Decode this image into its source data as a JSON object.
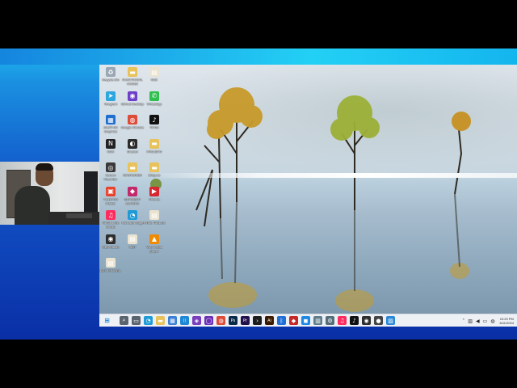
{
  "colors": {
    "stream_background": "#1256c9",
    "taskbar": "#edf1f6",
    "start_accent": "#0078d4"
  },
  "desktop": {
    "wallpaper": "misty lake with trees",
    "icons": [
      {
        "id": "recycle-bin",
        "label": "Recycle Bin",
        "icon": "recycle-bin-icon",
        "color": "#9aa7b4",
        "glyph": "♻"
      },
      {
        "id": "fpdf",
        "label": "FUNCTIONAL CODE2",
        "icon": "folder-icon",
        "color": "#e8c25a",
        "glyph": "▬"
      },
      {
        "id": "nsk",
        "label": "NSK",
        "icon": "document-icon",
        "color": "#e9e3d0",
        "glyph": "▤"
      },
      {
        "id": "telegram",
        "label": "Telegram",
        "icon": "telegram-icon",
        "color": "#2ea6de",
        "glyph": "➤"
      },
      {
        "id": "github",
        "label": "GitHub Desktop",
        "icon": "github-desktop-icon",
        "color": "#6e40c9",
        "glyph": "◉"
      },
      {
        "id": "whatsapp",
        "label": "WhatsApp",
        "icon": "whatsapp-icon",
        "color": "#30c04f",
        "glyph": "✆"
      },
      {
        "id": "intel",
        "label": "Intel® HD Graphics",
        "icon": "intel-graphics-icon",
        "color": "#1e6fd0",
        "glyph": "▦"
      },
      {
        "id": "chrome",
        "label": "Google Chrome",
        "icon": "chrome-icon",
        "color": "#de4b39",
        "glyph": "◍"
      },
      {
        "id": "tiktok",
        "label": "TikTok",
        "icon": "tiktok-icon",
        "color": "#111111",
        "glyph": "♪"
      },
      {
        "id": "nox",
        "label": "NOX",
        "icon": "nox-icon",
        "color": "#222222",
        "glyph": "N"
      },
      {
        "id": "obs",
        "label": "Shotcut",
        "icon": "shotcut-icon",
        "color": "#2b2b2b",
        "glyph": "◐"
      },
      {
        "id": "projeto",
        "label": "PROJETO",
        "icon": "folder-icon",
        "color": "#e8c25a",
        "glyph": "▬"
      },
      {
        "id": "camera",
        "label": "Screen Recorder",
        "icon": "screen-recorder-icon",
        "color": "#3a3a3a",
        "glyph": "◎"
      },
      {
        "id": "mastervids",
        "label": "MASTERIDS",
        "icon": "folder-icon",
        "color": "#e8c25a",
        "glyph": "▬"
      },
      {
        "id": "bloques",
        "label": "Bloques",
        "icon": "folder-icon",
        "color": "#e8c25a",
        "glyph": "▬"
      },
      {
        "id": "toolspro",
        "label": "ToolsPRO Master",
        "icon": "toolspro-icon",
        "color": "#e8432f",
        "glyph": "▣"
      },
      {
        "id": "gradient",
        "label": "GRADIENT BLOCKS",
        "icon": "gradient-icon",
        "color": "#c22a6b",
        "glyph": "◆"
      },
      {
        "id": "filmora",
        "label": "Filmora",
        "icon": "filmora-icon",
        "color": "#d8252f",
        "glyph": "▶"
      },
      {
        "id": "tiktok-live",
        "label": "TikTok LIVE Studio",
        "icon": "tiktok-live-icon",
        "color": "#ff2b5e",
        "glyph": "♫"
      },
      {
        "id": "edge",
        "label": "Microsoft Edge",
        "icon": "edge-icon",
        "color": "#1e9bd7",
        "glyph": "◔"
      },
      {
        "id": "html",
        "label": "HTML TABLES",
        "icon": "document-icon",
        "color": "#e9e3d0",
        "glyph": "▤"
      },
      {
        "id": "obs-studio",
        "label": "OBS Studio",
        "icon": "obs-icon",
        "color": "#2d2d2d",
        "glyph": "◉"
      },
      {
        "id": "vidt",
        "label": "VIDT",
        "icon": "document-icon",
        "color": "#e9e3d0",
        "glyph": "▤"
      },
      {
        "id": "vlc",
        "label": "VLC media player",
        "icon": "vlc-icon",
        "color": "#f08a00",
        "glyph": "▲"
      },
      {
        "id": "bdx",
        "label": "BDX IMMOBIL",
        "icon": "document-icon",
        "color": "#e9e3d0",
        "glyph": "▤"
      }
    ]
  },
  "taskbar": {
    "start_icon": "windows-start-icon",
    "items": [
      {
        "name": "search",
        "icon": "search-icon",
        "color": "#5a6470",
        "glyph": "⌕"
      },
      {
        "name": "task-view",
        "icon": "task-view-icon",
        "color": "#5a6470",
        "glyph": "▭"
      },
      {
        "name": "edge",
        "icon": "edge-icon",
        "color": "#1e9bd7",
        "glyph": "◔"
      },
      {
        "name": "file-explorer",
        "icon": "file-explorer-icon",
        "color": "#e8c25a",
        "glyph": "▬"
      },
      {
        "name": "store",
        "icon": "store-icon",
        "color": "#3d7fd6",
        "glyph": "▦"
      },
      {
        "name": "vscode",
        "icon": "vscode-icon",
        "color": "#1f88d6",
        "glyph": "⟨⟩"
      },
      {
        "name": "sketch",
        "icon": "app-icon",
        "color": "#7a3fbf",
        "glyph": "◈"
      },
      {
        "name": "circle-app",
        "icon": "circle-app-icon",
        "color": "#6a2fb5",
        "glyph": "◯"
      },
      {
        "name": "chrome",
        "icon": "chrome-icon",
        "color": "#de4b39",
        "glyph": "◍"
      },
      {
        "name": "photoshop",
        "icon": "photoshop-icon",
        "color": "#0b2a4a",
        "glyph": "Ps"
      },
      {
        "name": "premiere",
        "icon": "premiere-icon",
        "color": "#23104a",
        "glyph": "Pr"
      },
      {
        "name": "cmd",
        "icon": "terminal-icon",
        "color": "#1d1d1d",
        "glyph": "›"
      },
      {
        "name": "illustrator",
        "icon": "illustrator-icon",
        "color": "#3b1a00",
        "glyph": "Ai"
      },
      {
        "name": "bluetooth",
        "icon": "bluetooth-icon",
        "color": "#1f6fd6",
        "glyph": "ᛒ"
      },
      {
        "name": "app-red",
        "icon": "app-icon",
        "color": "#c62828",
        "glyph": "◆"
      },
      {
        "name": "app-blue",
        "icon": "app-icon",
        "color": "#1e88e5",
        "glyph": "◼"
      },
      {
        "name": "app-grey",
        "icon": "app-icon",
        "color": "#607d8b",
        "glyph": "▥"
      },
      {
        "name": "settings",
        "icon": "settings-icon",
        "color": "#546e7a",
        "glyph": "⚙"
      },
      {
        "name": "tiktok-live",
        "icon": "tiktok-live-icon",
        "color": "#ff2b5e",
        "glyph": "♫"
      },
      {
        "name": "tiktok",
        "icon": "tiktok-icon",
        "color": "#111111",
        "glyph": "♪"
      },
      {
        "name": "obs",
        "icon": "obs-icon",
        "color": "#2d2d2d",
        "glyph": "◉"
      },
      {
        "name": "recorder",
        "icon": "recorder-icon",
        "color": "#444444",
        "glyph": "●"
      },
      {
        "name": "photos",
        "icon": "photos-icon",
        "color": "#2b88d8",
        "glyph": "▨"
      }
    ],
    "tray": [
      {
        "icon": "chevron-up-icon",
        "glyph": "˄"
      },
      {
        "icon": "network-icon",
        "glyph": "▥"
      },
      {
        "icon": "speaker-icon",
        "glyph": "◀"
      },
      {
        "icon": "battery-icon",
        "glyph": "▭"
      },
      {
        "icon": "language-icon",
        "glyph": "◍"
      }
    ],
    "clock": {
      "time": "10:29 PM",
      "date": "6/11/2024"
    }
  }
}
